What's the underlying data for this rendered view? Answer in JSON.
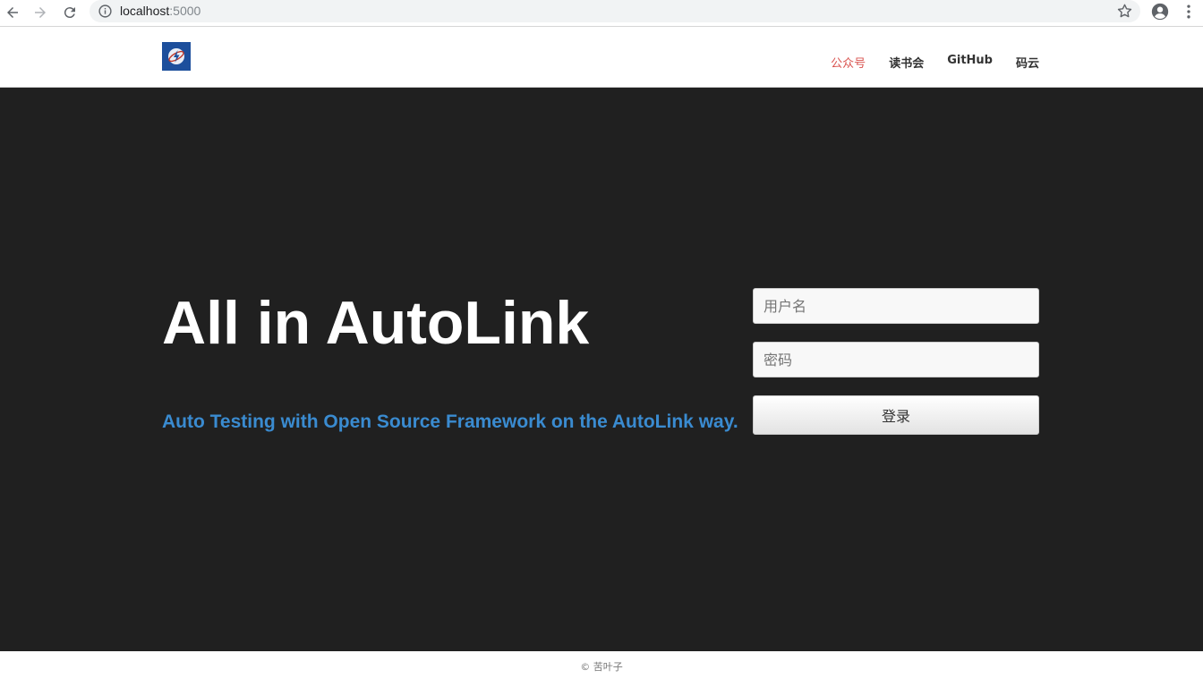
{
  "browser": {
    "url_host": "localhost",
    "url_port": ":5000",
    "icons": [
      "back-icon",
      "forward-icon",
      "reload-icon",
      "info-icon",
      "star-icon",
      "profile-icon",
      "menu-icon"
    ]
  },
  "header": {
    "logo_icon": "logo-icon",
    "nav": [
      {
        "label": "公众号",
        "active": true
      },
      {
        "label": "读书会",
        "active": false
      },
      {
        "label": "GitHub",
        "active": false
      },
      {
        "label": "码云",
        "active": false
      }
    ]
  },
  "hero": {
    "title": "All in AutoLink",
    "subtitle": "Auto Testing with Open Source Framework on the AutoLink way."
  },
  "login": {
    "username_placeholder": "用户名",
    "password_placeholder": "密码",
    "submit_label": "登录"
  },
  "footer": {
    "text": "© 苦叶子"
  },
  "colors": {
    "hero_bg": "#202020",
    "accent_blue": "#3a8bd0",
    "nav_active": "#d9534f"
  }
}
